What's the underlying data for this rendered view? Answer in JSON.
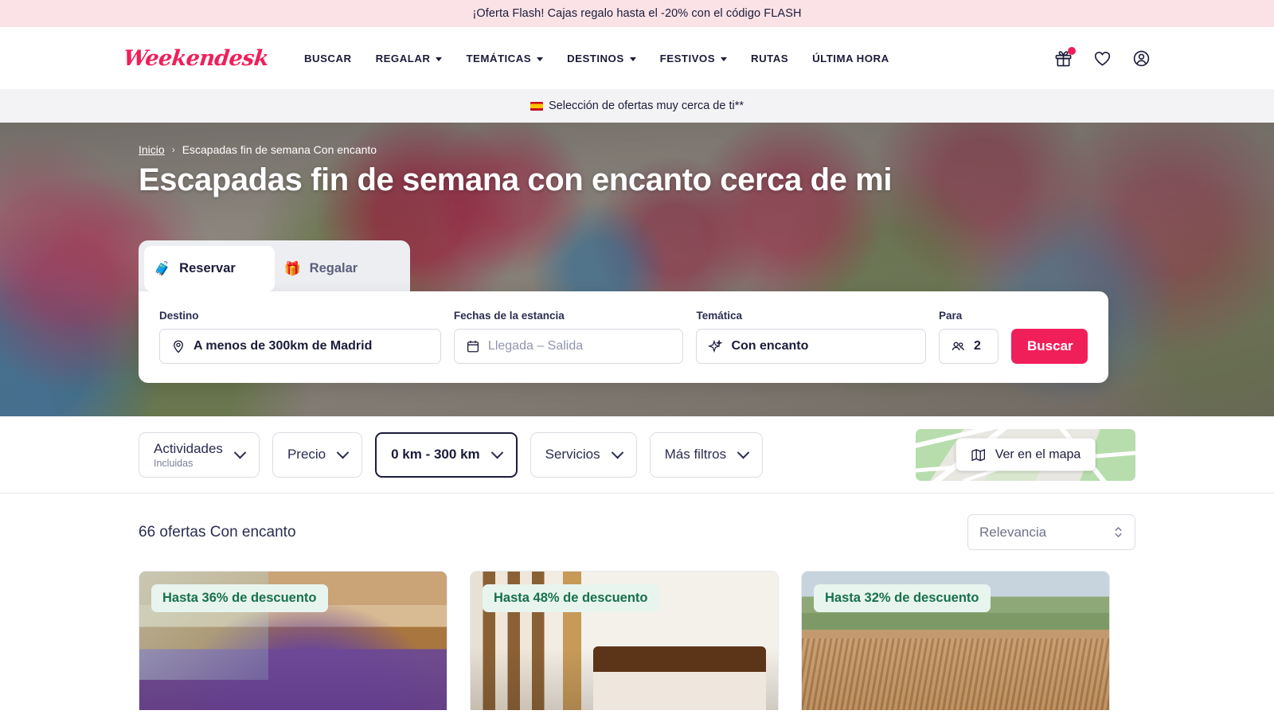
{
  "promo": {
    "text": "¡Oferta Flash! Cajas regalo hasta el -20% con el código FLASH"
  },
  "header": {
    "logo": "Weekendesk",
    "nav": [
      {
        "label": "BUSCAR",
        "has_caret": false
      },
      {
        "label": "REGALAR",
        "has_caret": true
      },
      {
        "label": "TEMÁTICAS",
        "has_caret": true
      },
      {
        "label": "DESTINOS",
        "has_caret": true
      },
      {
        "label": "FESTIVOS",
        "has_caret": true
      },
      {
        "label": "RUTAS",
        "has_caret": false
      },
      {
        "label": "ÚLTIMA HORA",
        "has_caret": false
      }
    ],
    "actions": [
      {
        "name": "gift-icon",
        "has_badge": true
      },
      {
        "name": "heart-icon",
        "has_badge": false
      },
      {
        "name": "account-icon",
        "has_badge": false
      }
    ]
  },
  "sub_banner": {
    "text": "Selección de ofertas muy cerca de ti**"
  },
  "hero": {
    "breadcrumb": {
      "home": "Inicio",
      "separator": "›",
      "current": "Escapadas fin de semana Con encanto"
    },
    "title": "Escapadas fin de semana con encanto cerca de mi"
  },
  "search": {
    "tabs": [
      {
        "label": "Reservar",
        "emoji": "🧳",
        "active": true
      },
      {
        "label": "Regalar",
        "emoji": "🎁",
        "active": false
      }
    ],
    "fields": {
      "destino": {
        "label": "Destino",
        "value": "A menos de 300km de Madrid",
        "icon": "location-pin-icon"
      },
      "fechas": {
        "label": "Fechas de la estancia",
        "placeholder": "Llegada – Salida",
        "icon": "calendar-icon"
      },
      "tematica": {
        "label": "Temática",
        "value": "Con encanto",
        "icon": "sparkle-icon"
      },
      "para": {
        "label": "Para",
        "value": "2",
        "icon": "people-icon"
      }
    },
    "submit_label": "Buscar"
  },
  "filters": {
    "chips": [
      {
        "label": "Actividades",
        "sub": "Incluidas",
        "active": false
      },
      {
        "label": "Precio",
        "sub": "",
        "active": false
      },
      {
        "label": "0 km - 300 km",
        "sub": "",
        "active": true
      },
      {
        "label": "Servicios",
        "sub": "",
        "active": false
      },
      {
        "label": "Más filtros",
        "sub": "",
        "active": false
      }
    ],
    "map_button": "Ver en el mapa"
  },
  "results": {
    "count_text": "66 ofertas Con encanto",
    "sort_value": "Relevancia",
    "cards": [
      {
        "badge": "Hasta 36% de descuento",
        "photo": "spa"
      },
      {
        "badge": "Hasta 48% de descuento",
        "photo": "room"
      },
      {
        "badge": "Hasta 32% de descuento",
        "photo": "village"
      }
    ]
  },
  "colors": {
    "brand_pink": "#f01f5a",
    "promo_bg": "#fbe2e6",
    "ink": "#1b1c3a",
    "badge_green_text": "#17704d",
    "badge_green_bg": "#e8f4ee"
  }
}
